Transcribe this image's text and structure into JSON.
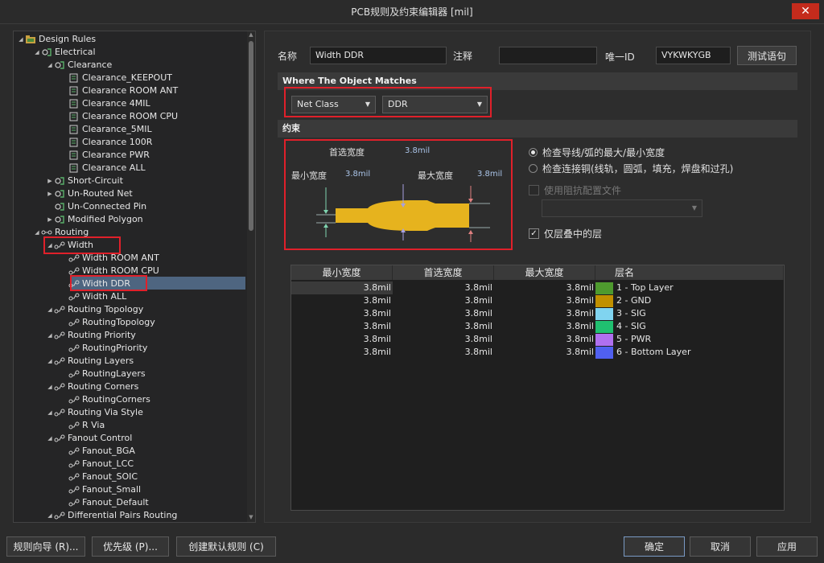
{
  "window": {
    "title": "PCB规则及约束编辑器 [mil]",
    "close_glyph": "✕"
  },
  "tree": [
    {
      "label": "Design Rules",
      "level": 0,
      "exp": "open",
      "icon": "folder-rules-icon"
    },
    {
      "label": "Electrical",
      "level": 1,
      "exp": "open",
      "icon": "rule-class-icon"
    },
    {
      "label": "Clearance",
      "level": 2,
      "exp": "open",
      "icon": "rule-class-icon"
    },
    {
      "label": "Clearance_KEEPOUT",
      "level": 3,
      "exp": "",
      "icon": "rule-icon"
    },
    {
      "label": "Clearance ROOM ANT",
      "level": 3,
      "exp": "",
      "icon": "rule-icon"
    },
    {
      "label": "Clearance 4MIL",
      "level": 3,
      "exp": "",
      "icon": "rule-icon"
    },
    {
      "label": "Clearance ROOM CPU",
      "level": 3,
      "exp": "",
      "icon": "rule-icon"
    },
    {
      "label": "Clearance_5MIL",
      "level": 3,
      "exp": "",
      "icon": "rule-icon"
    },
    {
      "label": "Clearance 100R",
      "level": 3,
      "exp": "",
      "icon": "rule-icon"
    },
    {
      "label": "Clearance PWR",
      "level": 3,
      "exp": "",
      "icon": "rule-icon"
    },
    {
      "label": "Clearance ALL",
      "level": 3,
      "exp": "",
      "icon": "rule-icon"
    },
    {
      "label": "Short-Circuit",
      "level": 2,
      "exp": "closed",
      "icon": "rule-class-icon"
    },
    {
      "label": "Un-Routed Net",
      "level": 2,
      "exp": "closed",
      "icon": "rule-class-icon"
    },
    {
      "label": "Un-Connected Pin",
      "level": 2,
      "exp": "",
      "icon": "rule-class-icon"
    },
    {
      "label": "Modified Polygon",
      "level": 2,
      "exp": "closed",
      "icon": "rule-class-icon"
    },
    {
      "label": "Routing",
      "level": 1,
      "exp": "open",
      "icon": "routing-class-icon"
    },
    {
      "label": "Width",
      "level": 2,
      "exp": "open",
      "icon": "routing-rule-icon"
    },
    {
      "label": "Width ROOM ANT",
      "level": 3,
      "exp": "",
      "icon": "routing-rule-icon"
    },
    {
      "label": "Width ROOM CPU",
      "level": 3,
      "exp": "",
      "icon": "routing-rule-icon"
    },
    {
      "label": "Width DDR",
      "level": 3,
      "exp": "",
      "icon": "routing-rule-icon"
    },
    {
      "label": "Width ALL",
      "level": 3,
      "exp": "",
      "icon": "routing-rule-icon"
    },
    {
      "label": "Routing Topology",
      "level": 2,
      "exp": "open",
      "icon": "routing-rule-icon"
    },
    {
      "label": "RoutingTopology",
      "level": 3,
      "exp": "",
      "icon": "routing-rule-icon"
    },
    {
      "label": "Routing Priority",
      "level": 2,
      "exp": "open",
      "icon": "routing-rule-icon"
    },
    {
      "label": "RoutingPriority",
      "level": 3,
      "exp": "",
      "icon": "routing-rule-icon"
    },
    {
      "label": "Routing Layers",
      "level": 2,
      "exp": "open",
      "icon": "routing-rule-icon"
    },
    {
      "label": "RoutingLayers",
      "level": 3,
      "exp": "",
      "icon": "routing-rule-icon"
    },
    {
      "label": "Routing Corners",
      "level": 2,
      "exp": "open",
      "icon": "routing-rule-icon"
    },
    {
      "label": "RoutingCorners",
      "level": 3,
      "exp": "",
      "icon": "routing-rule-icon"
    },
    {
      "label": "Routing Via Style",
      "level": 2,
      "exp": "open",
      "icon": "routing-rule-icon"
    },
    {
      "label": "R Via",
      "level": 3,
      "exp": "",
      "icon": "routing-rule-icon"
    },
    {
      "label": "Fanout Control",
      "level": 2,
      "exp": "open",
      "icon": "routing-rule-icon"
    },
    {
      "label": "Fanout_BGA",
      "level": 3,
      "exp": "",
      "icon": "routing-rule-icon"
    },
    {
      "label": "Fanout_LCC",
      "level": 3,
      "exp": "",
      "icon": "routing-rule-icon"
    },
    {
      "label": "Fanout_SOIC",
      "level": 3,
      "exp": "",
      "icon": "routing-rule-icon"
    },
    {
      "label": "Fanout_Small",
      "level": 3,
      "exp": "",
      "icon": "routing-rule-icon"
    },
    {
      "label": "Fanout_Default",
      "level": 3,
      "exp": "",
      "icon": "routing-rule-icon"
    },
    {
      "label": "Differential Pairs Routing",
      "level": 2,
      "exp": "open",
      "icon": "routing-rule-icon"
    }
  ],
  "selected_rule": "Width DDR",
  "form": {
    "name_label": "名称",
    "name_value": "Width DDR",
    "comment_label": "注释",
    "comment_value": "",
    "uid_label": "唯一ID",
    "uid_value": "VYKWKYGB",
    "test_button": "测试语句"
  },
  "match": {
    "header": "Where The Object Matches",
    "type": "Net Class",
    "value": "DDR"
  },
  "constraints": {
    "header": "约束",
    "preferred_label": "首选宽度",
    "preferred_value": "3.8mil",
    "min_label": "最小宽度",
    "min_value": "3.8mil",
    "max_label": "最大宽度",
    "max_value": "3.8mil",
    "opt_check_track": "检查导线/弧的最大/最小宽度",
    "opt_check_copper": "检查连接铜(线轨，圆弧，填充，焊盘和过孔)",
    "opt_impedance": "使用阻抗配置文件",
    "opt_stack_only": "仅层叠中的层",
    "trace_color": "#e6b31e"
  },
  "grid": {
    "headers": [
      "最小宽度",
      "首选宽度",
      "最大宽度",
      "层名"
    ],
    "rows": [
      {
        "min": "3.8mil",
        "pref": "3.8mil",
        "max": "3.8mil",
        "layer": "1 - Top Layer",
        "color": "#4e9a2e"
      },
      {
        "min": "3.8mil",
        "pref": "3.8mil",
        "max": "3.8mil",
        "layer": "2 - GND",
        "color": "#c09000"
      },
      {
        "min": "3.8mil",
        "pref": "3.8mil",
        "max": "3.8mil",
        "layer": "3 - SIG",
        "color": "#80d4f0"
      },
      {
        "min": "3.8mil",
        "pref": "3.8mil",
        "max": "3.8mil",
        "layer": "4 - SIG",
        "color": "#20c070"
      },
      {
        "min": "3.8mil",
        "pref": "3.8mil",
        "max": "3.8mil",
        "layer": "5 - PWR",
        "color": "#b070f0"
      },
      {
        "min": "3.8mil",
        "pref": "3.8mil",
        "max": "3.8mil",
        "layer": "6 - Bottom Layer",
        "color": "#5060f0"
      }
    ]
  },
  "buttons": {
    "wizard": "规则向导 (R)...",
    "priority": "优先级 (P)...",
    "create_default": "创建默认规则 (C)",
    "ok": "确定",
    "cancel": "取消",
    "apply": "应用"
  }
}
